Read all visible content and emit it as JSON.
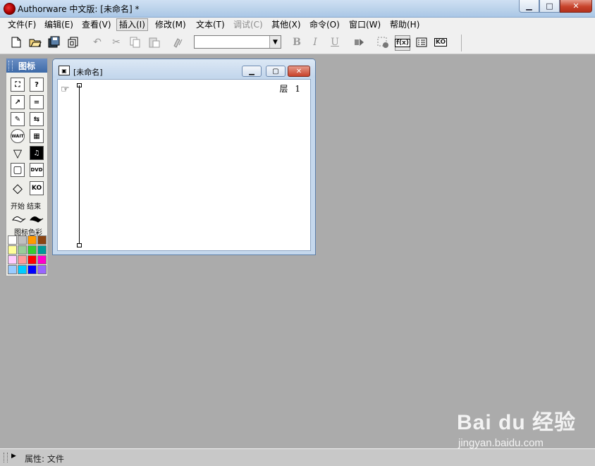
{
  "window": {
    "title": "Authorware 中文版: [未命名] *",
    "buttons": {
      "minimize": "▁",
      "maximize": "□",
      "close": "✕"
    }
  },
  "menu": {
    "items": [
      {
        "label": "文件(F)",
        "state": "normal"
      },
      {
        "label": "编辑(E)",
        "state": "normal"
      },
      {
        "label": "查看(V)",
        "state": "normal"
      },
      {
        "label": "插入(I)",
        "state": "active"
      },
      {
        "label": "修改(M)",
        "state": "normal"
      },
      {
        "label": "文本(T)",
        "state": "normal"
      },
      {
        "label": "调试(C)",
        "state": "disabled"
      },
      {
        "label": "其他(X)",
        "state": "normal"
      },
      {
        "label": "命令(O)",
        "state": "normal"
      },
      {
        "label": "窗口(W)",
        "state": "normal"
      },
      {
        "label": "帮助(H)",
        "state": "normal"
      }
    ]
  },
  "toolbar": {
    "icons": [
      "new-file-icon",
      "open-icon",
      "save-all-icon",
      "import-icon",
      "undo-icon",
      "cut-icon",
      "copy-icon",
      "paste-icon",
      "find-icon",
      "bold-icon",
      "italic-icon",
      "underline-icon",
      "run-icon",
      "control-panel-icon",
      "functions-icon",
      "variables-icon",
      "knowledge-objects-icon"
    ],
    "font_value": "",
    "bold": "B",
    "italic": "I",
    "underline": "U",
    "functions": "f(x)",
    "ko": "KO"
  },
  "palette": {
    "title": "图标",
    "start_end_label": "开始  结束",
    "icon_colors_label": "图标色彩",
    "icons": [
      {
        "name": "display-icon-tool",
        "glyph": "⛶"
      },
      {
        "name": "decision-icon-tool",
        "glyph": "?"
      },
      {
        "name": "motion-icon-tool",
        "glyph": "↗"
      },
      {
        "name": "calculation-icon-tool",
        "glyph": "="
      },
      {
        "name": "erase-icon-tool",
        "glyph": "✎"
      },
      {
        "name": "navigate-icon-tool",
        "glyph": "⇆"
      },
      {
        "name": "wait-icon-tool",
        "glyph": "WAIT"
      },
      {
        "name": "digital-movie-icon-tool",
        "glyph": "▦"
      },
      {
        "name": "framework-icon-tool",
        "glyph": "▽"
      },
      {
        "name": "sound-icon-tool",
        "glyph": "♫"
      },
      {
        "name": "map-icon-tool",
        "glyph": "▢"
      },
      {
        "name": "video-icon-tool",
        "glyph": "DVD"
      },
      {
        "name": "interaction-icon-tool",
        "glyph": "◇"
      },
      {
        "name": "ko-icon-tool",
        "glyph": "KO"
      }
    ],
    "colors": [
      "#ffffff",
      "#c0c0c0",
      "#ff9900",
      "#8b4513",
      "#ffff99",
      "#99cc99",
      "#33cc33",
      "#009999",
      "#ffccff",
      "#ff9999",
      "#ff0000",
      "#ff00cc",
      "#99ccff",
      "#00ccff",
      "#0000ff",
      "#9966ff"
    ]
  },
  "design_window": {
    "title": "[未命名]",
    "layer_label": "层",
    "layer_value": "1"
  },
  "statusbar": {
    "text": "属性: 文件"
  },
  "watermark": {
    "brand": "Bai du 经验",
    "url": "jingyan.baidu.com"
  }
}
